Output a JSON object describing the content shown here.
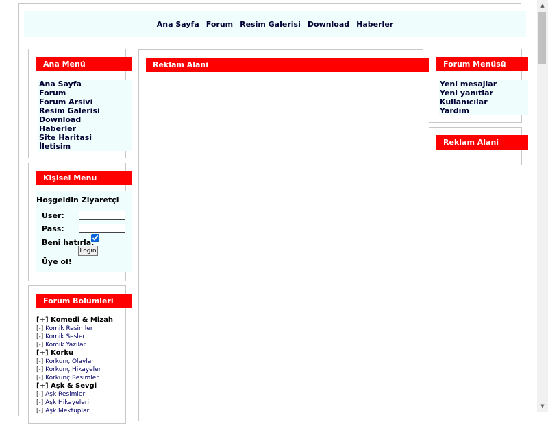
{
  "topnav": {
    "items": [
      "Ana Sayfa",
      "Forum",
      "Resim Galerisi",
      "Download",
      "Haberler"
    ]
  },
  "left": {
    "ana_menu": {
      "title": "Ana Menü",
      "items": [
        "Ana Sayfa",
        "Forum",
        "Forum Arsivi",
        "Resim Galerisi",
        "Download",
        "Haberler",
        "Site Haritasi",
        "İletisim"
      ]
    },
    "kisisel_menu": {
      "title": "Kişisel Menu",
      "welcome": "Hoşgeldin Ziyaretçi",
      "user_label": "User:",
      "user_value": "",
      "pass_label": "Pass:",
      "pass_value": "",
      "remember_label": "Beni hatırla:",
      "remember_checked": true,
      "login_label": "Login",
      "register_label": "Üye ol!"
    },
    "forum_bolumleri": {
      "title": "Forum Bölümleri",
      "sections": [
        {
          "name": "[+] Komedi & Mizah",
          "items": [
            "Komik Resimler",
            "Komik Sesler",
            "Komik Yazılar"
          ]
        },
        {
          "name": "[+] Korku",
          "items": [
            "Korkunç Olaylar",
            "Korkunç Hikayeler",
            "Korkunç Resimler"
          ]
        },
        {
          "name": "[+] Aşk & Sevgi",
          "items": [
            "Aşk Resimleri",
            "Aşk Hikayeleri",
            "Aşk Mektupları"
          ]
        }
      ]
    }
  },
  "center": {
    "title": "Reklam Alani"
  },
  "right": {
    "forum_menusu": {
      "title": "Forum Menüsü",
      "items": [
        "Yeni mesajlar",
        "Yeni yanıtlar",
        "Kullanıcılar",
        "Yardım"
      ]
    },
    "reklam": {
      "title": "Reklam Alani"
    }
  },
  "colors": {
    "box_title_bg": "#ff0000",
    "panel_bg": "#f0fdfd",
    "link_color": "#000033"
  }
}
